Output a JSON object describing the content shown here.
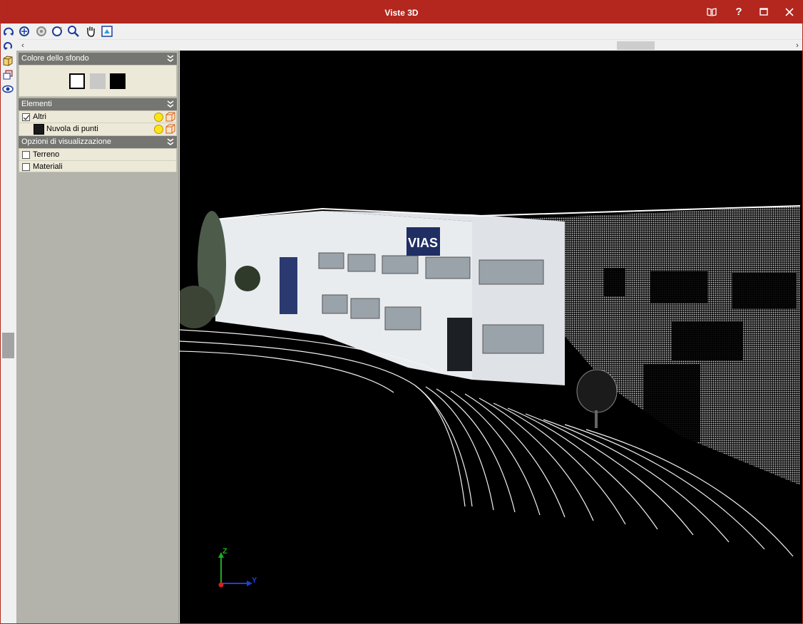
{
  "window": {
    "title": "Viste 3D"
  },
  "panel": {
    "background_section": {
      "title": "Colore dello sfondo",
      "swatches": [
        {
          "name": "white",
          "color": "#ffffff",
          "selected": true
        },
        {
          "name": "gray",
          "color": "#c8c8c8",
          "selected": false
        },
        {
          "name": "black",
          "color": "#000000",
          "selected": false
        }
      ]
    },
    "elements_section": {
      "title": "Elementi",
      "items": [
        {
          "label": "Altri",
          "checked": true
        },
        {
          "label": "Nuvola di punti",
          "checked": false
        }
      ]
    },
    "options_section": {
      "title": "Opzioni di visualizzazione",
      "items": [
        {
          "label": "Terreno",
          "checked": false
        },
        {
          "label": "Materiali",
          "checked": false
        }
      ]
    }
  },
  "viewport": {
    "sign_text": "VIAS",
    "axes": {
      "z": "Z",
      "y": "Y"
    }
  },
  "colors": {
    "titlebar": "#b3271e",
    "panel_bg": "#b3b3ab",
    "section_header": "#757571",
    "viewport_bg": "#000000"
  }
}
